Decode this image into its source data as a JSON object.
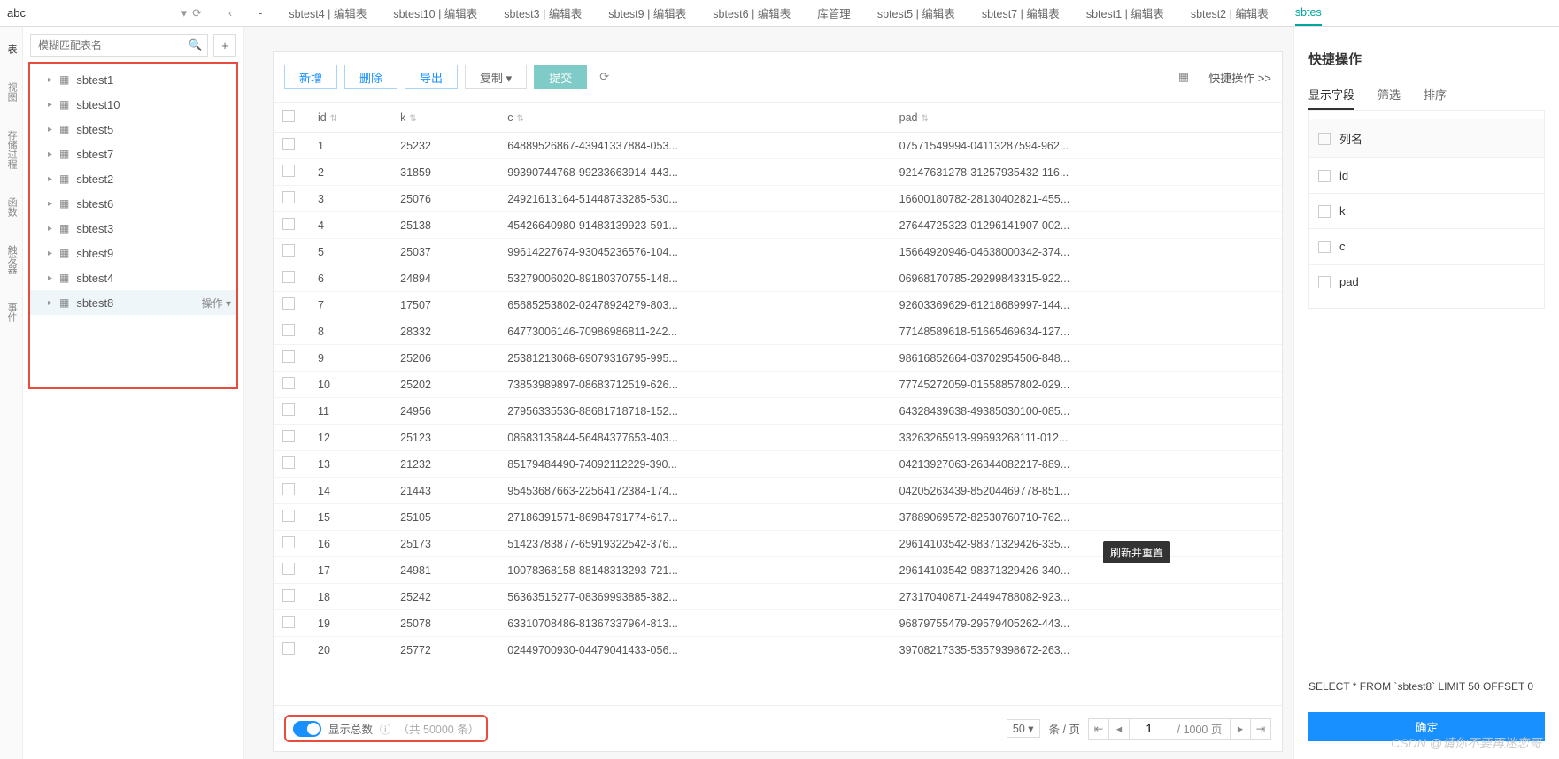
{
  "db_name": "abc",
  "search_placeholder": "模糊匹配表名",
  "nav_rail": [
    "表",
    "视图",
    "存储过程",
    "函数",
    "触发器",
    "事件"
  ],
  "tabs": [
    {
      "label": "-"
    },
    {
      "label": "sbtest4 | 编辑表"
    },
    {
      "label": "sbtest10 | 编辑表"
    },
    {
      "label": "sbtest3 | 编辑表"
    },
    {
      "label": "sbtest9 | 编辑表"
    },
    {
      "label": "sbtest6 | 编辑表"
    },
    {
      "label": "库管理"
    },
    {
      "label": "sbtest5 | 编辑表"
    },
    {
      "label": "sbtest7 | 编辑表"
    },
    {
      "label": "sbtest1 | 编辑表"
    },
    {
      "label": "sbtest2 | 编辑表"
    },
    {
      "label": "sbtes",
      "active": true
    }
  ],
  "tree": [
    {
      "label": "sbtest1"
    },
    {
      "label": "sbtest10"
    },
    {
      "label": "sbtest5"
    },
    {
      "label": "sbtest7"
    },
    {
      "label": "sbtest2"
    },
    {
      "label": "sbtest6"
    },
    {
      "label": "sbtest3"
    },
    {
      "label": "sbtest9"
    },
    {
      "label": "sbtest4"
    },
    {
      "label": "sbtest8",
      "selected": true,
      "action": "操作 ▾"
    }
  ],
  "toolbar": {
    "add": "新增",
    "delete": "删除",
    "export": "导出",
    "copy": "复制 ▾",
    "submit": "提交",
    "quick": "快捷操作 >>"
  },
  "columns": [
    "",
    "id",
    "k",
    "c",
    "pad"
  ],
  "rows": [
    {
      "id": "1",
      "k": "25232",
      "c": "64889526867-43941337884-053...",
      "pad": "07571549994-04113287594-962..."
    },
    {
      "id": "2",
      "k": "31859",
      "c": "99390744768-99233663914-443...",
      "pad": "92147631278-31257935432-116..."
    },
    {
      "id": "3",
      "k": "25076",
      "c": "24921613164-51448733285-530...",
      "pad": "16600180782-28130402821-455..."
    },
    {
      "id": "4",
      "k": "25138",
      "c": "45426640980-91483139923-591...",
      "pad": "27644725323-01296141907-002..."
    },
    {
      "id": "5",
      "k": "25037",
      "c": "99614227674-93045236576-104...",
      "pad": "15664920946-04638000342-374..."
    },
    {
      "id": "6",
      "k": "24894",
      "c": "53279006020-89180370755-148...",
      "pad": "06968170785-29299843315-922..."
    },
    {
      "id": "7",
      "k": "17507",
      "c": "65685253802-02478924279-803...",
      "pad": "92603369629-61218689997-144..."
    },
    {
      "id": "8",
      "k": "28332",
      "c": "64773006146-70986986811-242...",
      "pad": "77148589618-51665469634-127..."
    },
    {
      "id": "9",
      "k": "25206",
      "c": "25381213068-69079316795-995...",
      "pad": "98616852664-03702954506-848..."
    },
    {
      "id": "10",
      "k": "25202",
      "c": "73853989897-08683712519-626...",
      "pad": "77745272059-01558857802-029..."
    },
    {
      "id": "11",
      "k": "24956",
      "c": "27956335536-88681718718-152...",
      "pad": "64328439638-49385030100-085..."
    },
    {
      "id": "12",
      "k": "25123",
      "c": "08683135844-56484377653-403...",
      "pad": "33263265913-99693268111-012..."
    },
    {
      "id": "13",
      "k": "21232",
      "c": "85179484490-74092112229-390...",
      "pad": "04213927063-26344082217-889..."
    },
    {
      "id": "14",
      "k": "21443",
      "c": "95453687663-22564172384-174...",
      "pad": "04205263439-85204469778-851..."
    },
    {
      "id": "15",
      "k": "25105",
      "c": "27186391571-86984791774-617...",
      "pad": "37889069572-82530760710-762..."
    },
    {
      "id": "16",
      "k": "25173",
      "c": "51423783877-65919322542-376...",
      "pad": "29614103542-98371329426-335..."
    },
    {
      "id": "17",
      "k": "24981",
      "c": "10078368158-88148313293-721...",
      "pad": "29614103542-98371329426-340..."
    },
    {
      "id": "18",
      "k": "25242",
      "c": "56363515277-08369993885-382...",
      "pad": "27317040871-24494788082-923..."
    },
    {
      "id": "19",
      "k": "25078",
      "c": "63310708486-81367337964-813...",
      "pad": "96879755479-29579405262-443..."
    },
    {
      "id": "20",
      "k": "25772",
      "c": "02449700930-04479041433-056...",
      "pad": "39708217335-53579398672-263..."
    }
  ],
  "tooltip": "刷新并重置",
  "footer": {
    "show_total": "显示总数",
    "total": "（共 50000 条）",
    "page_size": "50 ▾",
    "per_page": "条 / 页",
    "page_input": "1",
    "page_total": "/ 1000 页"
  },
  "right": {
    "title": "快捷操作",
    "tabs": [
      "显示字段",
      "筛选",
      "排序"
    ],
    "field_header": "列名",
    "fields": [
      "id",
      "k",
      "c",
      "pad"
    ],
    "sql": "SELECT * FROM `sbtest8` LIMIT 50 OFFSET 0",
    "confirm": "确定"
  },
  "watermark": "CSDN @请你不要再迷恋哥"
}
